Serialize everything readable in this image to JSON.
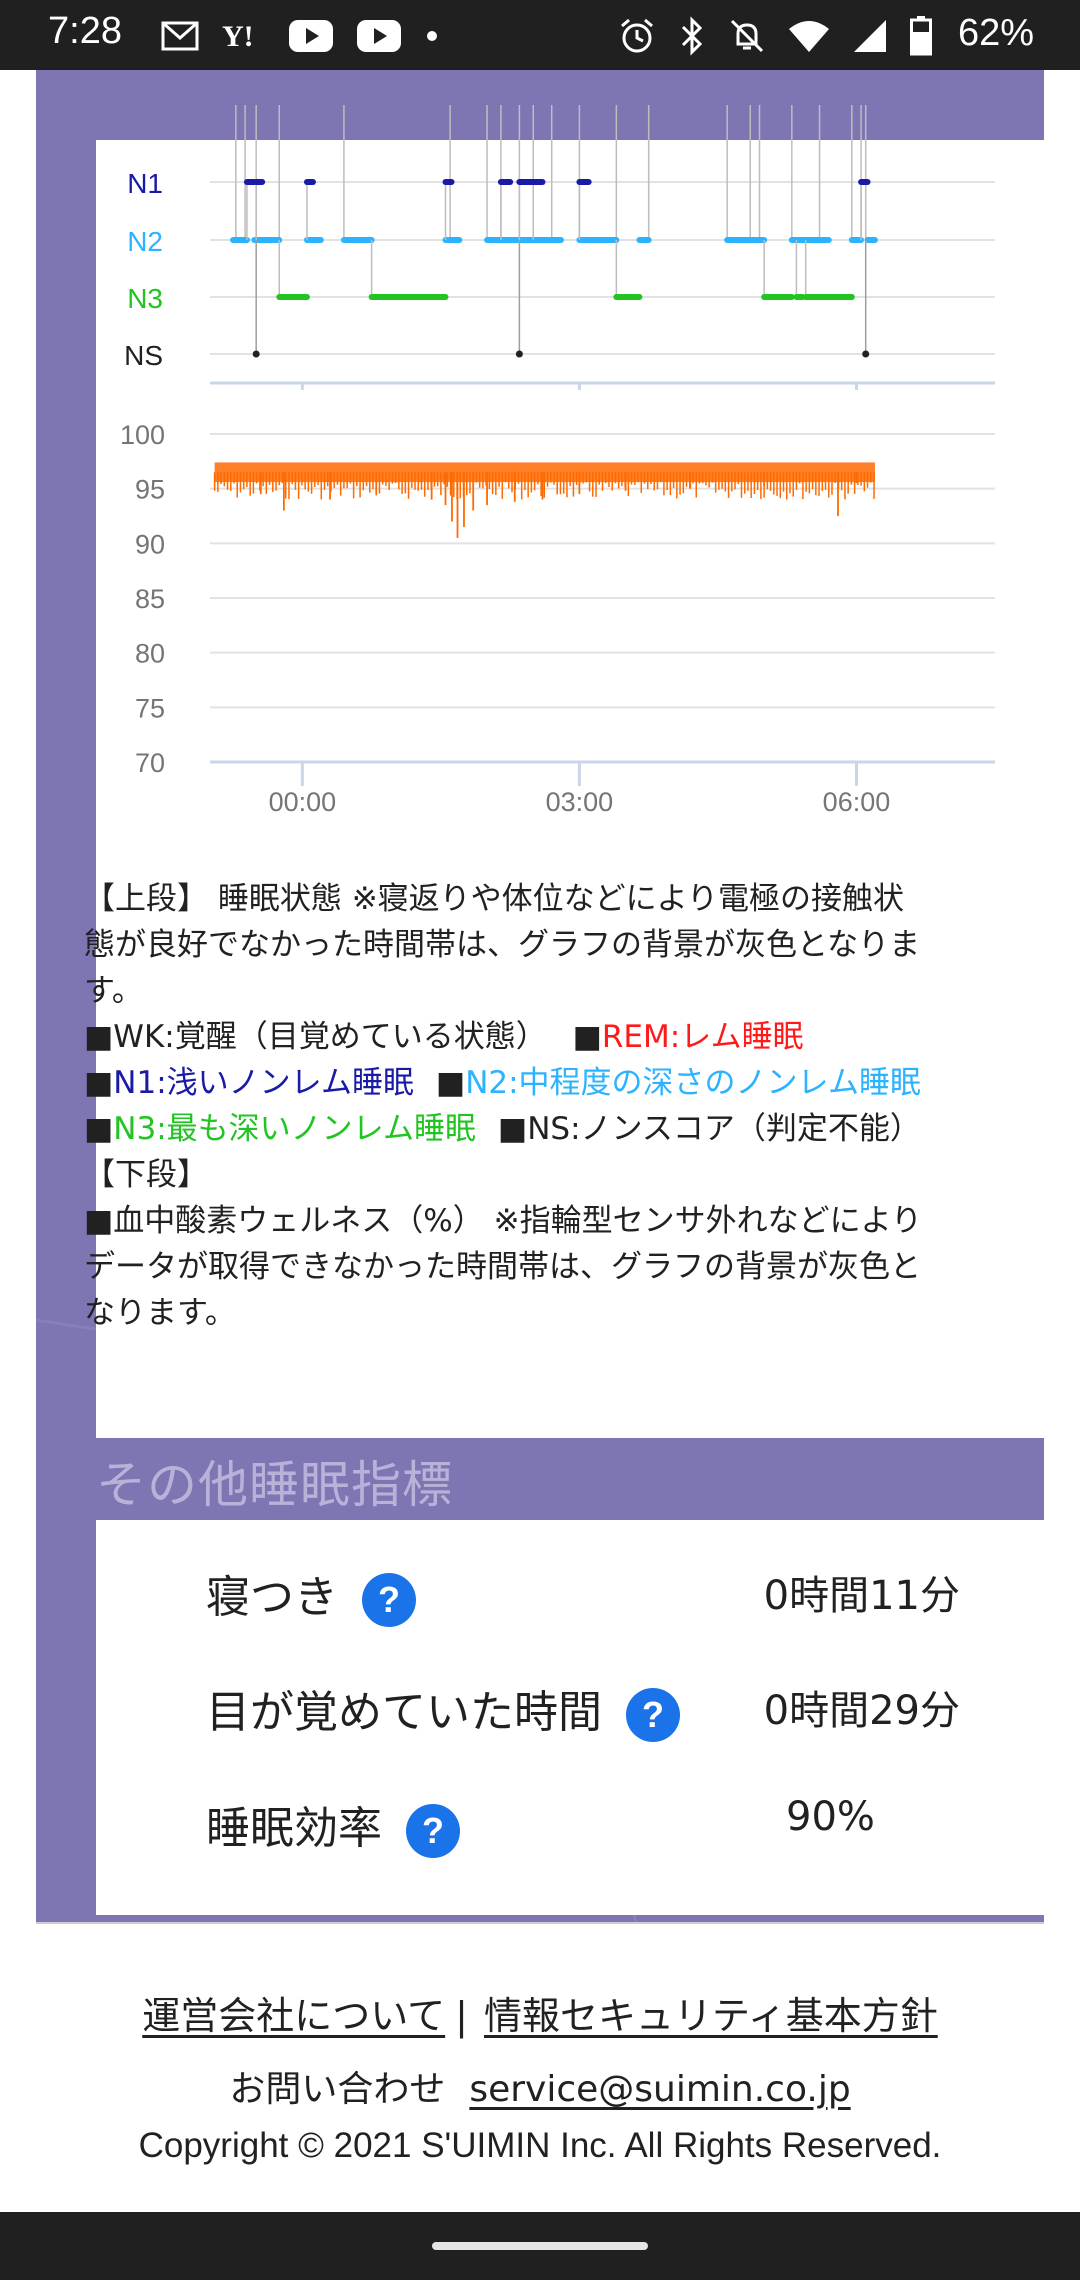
{
  "status_bar": {
    "time": "7:28",
    "battery_text": "62%",
    "left_icons": [
      "mail-icon",
      "yahoo-icon",
      "youtube-icon",
      "youtube-icon",
      "dot-icon"
    ],
    "right_icons": [
      "alarm-icon",
      "bluetooth-icon",
      "mute-icon",
      "wifi-icon",
      "signal-icon",
      "battery-icon"
    ]
  },
  "chart_data": [
    {
      "type": "line",
      "kind": "hypnogram",
      "y_categories": [
        "N1",
        "N2",
        "N3",
        "NS"
      ],
      "y_category_colors": [
        "#1a1aa6",
        "#2bb3ff",
        "#22c422",
        "#212121"
      ],
      "x_tick_labels": [
        "00:00",
        "03:00",
        "06:00"
      ],
      "x_tick_hours": [
        0,
        3,
        6
      ],
      "x_range_hours": [
        -1.0,
        7.5
      ],
      "segments": [
        {
          "stage": "N2",
          "start": -0.75,
          "end": -0.6
        },
        {
          "stage": "N1",
          "start": -0.6,
          "end": -0.52
        },
        {
          "stage": "N2",
          "start": -0.52,
          "end": -0.5
        },
        {
          "stage": "N1",
          "start": -0.5,
          "end": -0.44
        },
        {
          "stage": "N2",
          "start": -0.44,
          "end": -0.25
        },
        {
          "stage": "N3",
          "start": -0.25,
          "end": 0.05
        },
        {
          "stage": "N2",
          "start": 0.05,
          "end": 0.2
        },
        {
          "stage": "N1",
          "start": 0.05,
          "end": 0.1
        },
        {
          "stage": "N2",
          "start": 0.45,
          "end": 0.75
        },
        {
          "stage": "N3",
          "start": 0.75,
          "end": 1.55
        },
        {
          "stage": "N2",
          "start": 1.55,
          "end": 1.7
        },
        {
          "stage": "N1",
          "start": 1.55,
          "end": 1.6
        },
        {
          "stage": "N2",
          "start": 2.0,
          "end": 2.8
        },
        {
          "stage": "N1",
          "start": 2.15,
          "end": 2.25
        },
        {
          "stage": "N1",
          "start": 2.35,
          "end": 2.5
        },
        {
          "stage": "N1",
          "start": 2.5,
          "end": 2.6
        },
        {
          "stage": "N2",
          "start": 3.0,
          "end": 3.4
        },
        {
          "stage": "N1",
          "start": 3.0,
          "end": 3.1
        },
        {
          "stage": "N3",
          "start": 3.4,
          "end": 3.65
        },
        {
          "stage": "N2",
          "start": 3.65,
          "end": 3.75
        },
        {
          "stage": "N2",
          "start": 4.6,
          "end": 5.0
        },
        {
          "stage": "N3",
          "start": 5.0,
          "end": 5.3
        },
        {
          "stage": "N2",
          "start": 5.3,
          "end": 5.7
        },
        {
          "stage": "N3",
          "start": 5.35,
          "end": 5.4
        },
        {
          "stage": "N3",
          "start": 5.45,
          "end": 5.95
        },
        {
          "stage": "N2",
          "start": 5.95,
          "end": 6.05
        },
        {
          "stage": "N1",
          "start": 6.05,
          "end": 6.12
        },
        {
          "stage": "N2",
          "start": 6.12,
          "end": 6.2
        }
      ],
      "ns_points": [
        -0.5,
        2.35,
        6.1
      ],
      "wake_transitions": [
        -0.72,
        -0.62,
        -0.5,
        -0.25,
        0.45,
        1.6,
        2.0,
        2.15,
        2.35,
        2.5,
        2.7,
        3.0,
        3.4,
        3.75,
        4.6,
        4.85,
        4.95,
        5.3,
        5.6,
        5.95,
        6.05,
        6.1
      ]
    },
    {
      "type": "line",
      "kind": "spo2",
      "y_tick_labels": [
        "100",
        "95",
        "90",
        "85",
        "80",
        "75",
        "70"
      ],
      "ylim": [
        70,
        100
      ],
      "x_tick_labels": [
        "00:00",
        "03:00",
        "06:00"
      ],
      "x_tick_hours": [
        0,
        3,
        6
      ],
      "x_range_hours": [
        -1.0,
        7.5
      ],
      "data_range_hours": [
        -0.95,
        6.2
      ],
      "baseline": 96.5,
      "dips": [
        {
          "x": -0.45,
          "y": 94.5
        },
        {
          "x": -0.2,
          "y": 93.0
        },
        {
          "x": 0.3,
          "y": 94.0
        },
        {
          "x": 0.8,
          "y": 94.5
        },
        {
          "x": 1.4,
          "y": 94.0
        },
        {
          "x": 1.55,
          "y": 93.5
        },
        {
          "x": 1.62,
          "y": 92.0
        },
        {
          "x": 1.68,
          "y": 90.5
        },
        {
          "x": 1.75,
          "y": 91.5
        },
        {
          "x": 1.85,
          "y": 93.0
        },
        {
          "x": 2.0,
          "y": 93.5
        },
        {
          "x": 2.3,
          "y": 93.8
        },
        {
          "x": 2.6,
          "y": 94.0
        },
        {
          "x": 3.0,
          "y": 94.5
        },
        {
          "x": 3.5,
          "y": 94.8
        },
        {
          "x": 4.2,
          "y": 95.0
        },
        {
          "x": 5.0,
          "y": 95.2
        },
        {
          "x": 5.8,
          "y": 92.5
        },
        {
          "x": 6.0,
          "y": 95.5
        }
      ],
      "line_color": "#ff6a00"
    }
  ],
  "legend": {
    "line1": "【上段】 睡眠状態 ※寝返りや体位などにより電極の接触状",
    "line2": "態が良好でなかった時間帯は、グラフの背景が灰色となりま",
    "line3": "す。",
    "square": "■",
    "wk": "WK:覚醒（目覚めている状態）",
    "rem": "REM:レム睡眠",
    "n1": "N1:浅いノンレム睡眠",
    "n2": "N2:中程度の深さのノンレム睡眠",
    "n3": "N3:最も深いノンレム睡眠",
    "ns": "NS:ノンスコア（判定不能）",
    "lower_heading": "【下段】",
    "spo2_line1": "血中酸素ウェルネス（%） ※指輪型センサ外れなどにより",
    "spo2_line2": "データが取得できなかった時間帯は、グラフの背景が灰色と",
    "spo2_line3": "なります。"
  },
  "section": {
    "title": "その他睡眠指標"
  },
  "metrics": [
    {
      "label": "寝つき",
      "value": "0時間11分"
    },
    {
      "label": "目が覚めていた時間",
      "value": "0時間29分"
    },
    {
      "label": "睡眠効率",
      "value": "90%"
    }
  ],
  "help_icon_text": "?",
  "footer": {
    "link_company": "運営会社について",
    "separator": "|",
    "link_security": "情報セキュリティ基本方針",
    "contact_label": "お問い合わせ",
    "contact_email": "service@suimin.co.jp",
    "copyright": "Copyright © 2021 S'UIMIN Inc. All Rights Reserved."
  },
  "colors": {
    "panel": "#7e75b3",
    "n1": "#1a1aa6",
    "n2": "#2bb3ff",
    "n3": "#22c422",
    "spo2": "#ff6a00",
    "help": "#1a73e8"
  }
}
